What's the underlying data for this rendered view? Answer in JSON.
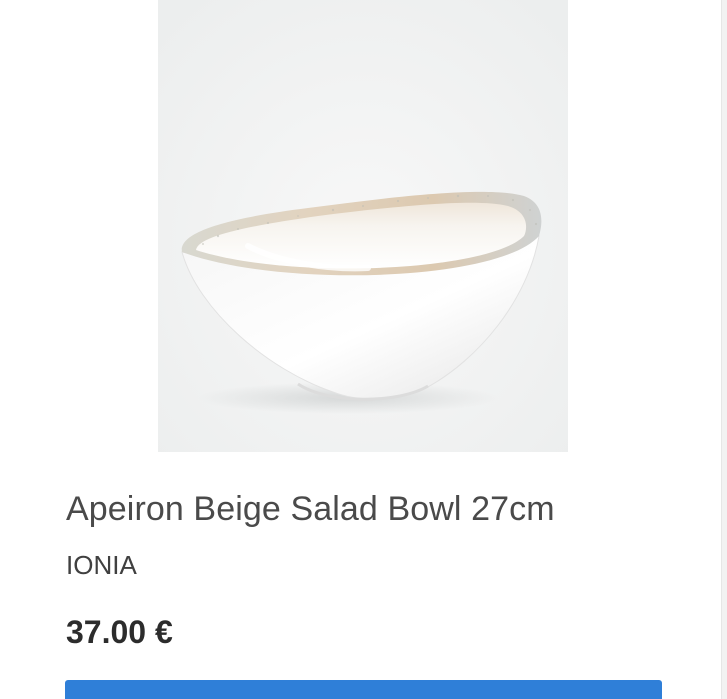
{
  "product": {
    "title": "Apeiron Beige Salad Bowl 27cm",
    "brand": "IONIA",
    "price": "37.00 €",
    "image_subject": "white oval salad bowl with beige speckled rim"
  },
  "colors": {
    "button": "#2f7fd8",
    "image_background": "#f3f4f4",
    "bowl_rim": "#d9c7ad",
    "text_primary": "#4a4a4a"
  }
}
